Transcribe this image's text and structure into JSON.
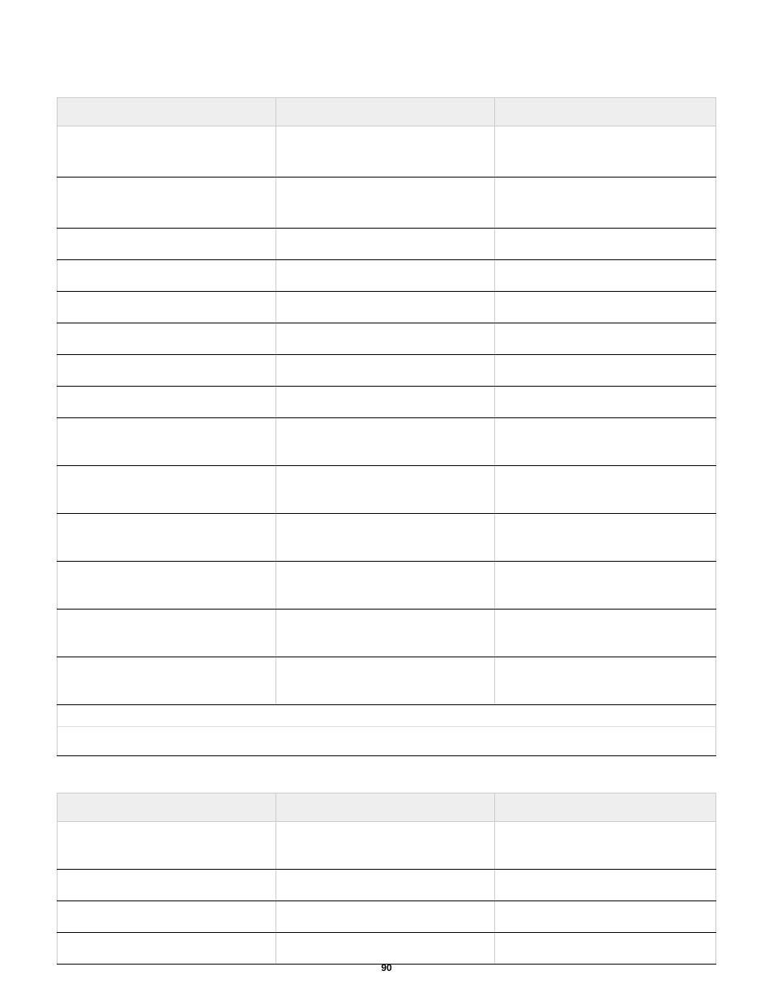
{
  "page_number": "90",
  "table1": {
    "headers": [
      "",
      "",
      ""
    ],
    "rows": [
      {
        "heightClass": "h-tall",
        "cells": [
          "",
          "",
          ""
        ]
      },
      {
        "heightClass": "h-tall",
        "cells": [
          "",
          "",
          ""
        ]
      },
      {
        "heightClass": "h-short",
        "cells": [
          "",
          "",
          ""
        ]
      },
      {
        "heightClass": "h-short",
        "cells": [
          "",
          "",
          ""
        ]
      },
      {
        "heightClass": "h-short",
        "cells": [
          "",
          "",
          ""
        ]
      },
      {
        "heightClass": "h-short",
        "cells": [
          "",
          "",
          ""
        ]
      },
      {
        "heightClass": "h-short",
        "cells": [
          "",
          "",
          ""
        ]
      },
      {
        "heightClass": "h-short",
        "cells": [
          "",
          "",
          ""
        ]
      },
      {
        "heightClass": "h-med",
        "cells": [
          "",
          "",
          ""
        ]
      },
      {
        "heightClass": "h-med",
        "cells": [
          "",
          "",
          ""
        ]
      },
      {
        "heightClass": "h-med",
        "cells": [
          "",
          "",
          ""
        ]
      },
      {
        "heightClass": "h-med",
        "cells": [
          "",
          "",
          ""
        ]
      },
      {
        "heightClass": "h-med",
        "cells": [
          "",
          "",
          ""
        ]
      },
      {
        "heightClass": "h-med",
        "cells": [
          "",
          "",
          ""
        ]
      },
      {
        "heightClass": "h-tall",
        "fullspan": true,
        "content": ""
      }
    ]
  },
  "table2": {
    "headers": [
      "",
      "",
      ""
    ],
    "rows": [
      {
        "heightClass": "h-med",
        "cells": [
          "",
          "",
          ""
        ]
      },
      {
        "heightClass": "h-short",
        "cells": [
          "",
          "",
          ""
        ]
      },
      {
        "heightClass": "h-short",
        "cells": [
          "",
          "",
          ""
        ]
      },
      {
        "heightClass": "h-short",
        "cells": [
          "",
          "",
          ""
        ]
      }
    ]
  }
}
